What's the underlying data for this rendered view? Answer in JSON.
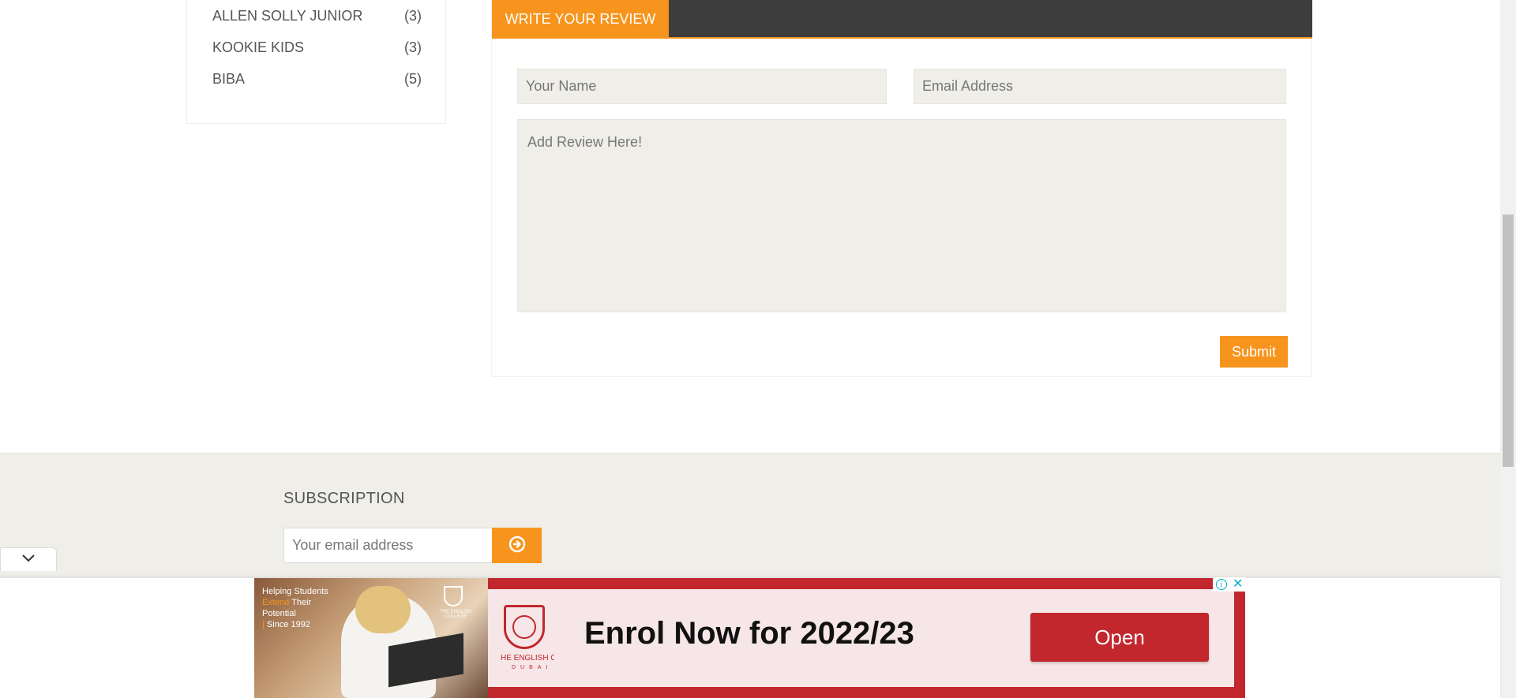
{
  "sidebar": {
    "brands": [
      {
        "name": "ALLEN SOLLY JUNIOR",
        "count": "(3)"
      },
      {
        "name": "KOOKIE KIDS",
        "count": "(3)"
      },
      {
        "name": "BIBA",
        "count": "(5)"
      }
    ]
  },
  "review": {
    "tab_label": "WRITE YOUR REVIEW",
    "name_placeholder": "Your Name",
    "email_placeholder": "Email Address",
    "review_placeholder": "Add Review Here!",
    "submit_label": "Submit"
  },
  "subscription": {
    "title": "SUBSCRIPTION",
    "email_placeholder": "Your email address",
    "submit_icon": "arrow-circle-right-icon"
  },
  "ad": {
    "copy_line1": "Helping Students",
    "copy_highlight": "Extend",
    "copy_line2": "Their",
    "copy_line3": "Potential",
    "copy_line4": "Since 1992",
    "small_crest_label": "THE ENGLISH COLLEGE",
    "school_name": "HE ENGLISH COLLEG",
    "school_sub": "DUBAI",
    "headline": "Enrol Now for 2022/23",
    "button_label": "Open",
    "info_icon": "info-icon",
    "close_icon": "close-icon"
  },
  "colors": {
    "accent": "#f7941d",
    "header_dark": "#3e3e3e",
    "field_bg": "#efeee9",
    "ad_red": "#c1272d"
  }
}
